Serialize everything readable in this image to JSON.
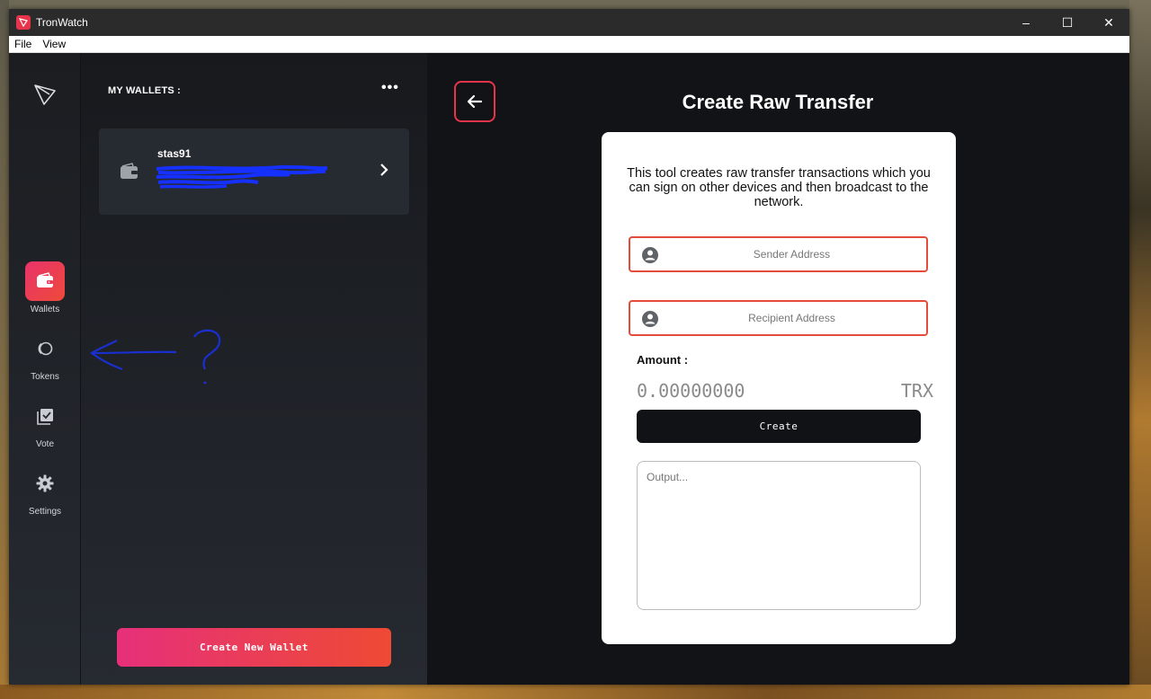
{
  "window": {
    "title": "TronWatch",
    "controls": {
      "minimize": "–",
      "maximize": "☐",
      "close": "✕"
    }
  },
  "menu": {
    "items": [
      "File",
      "View"
    ]
  },
  "sidebar": {
    "items": [
      {
        "label": "Wallets",
        "icon": "wallet-icon",
        "active": true
      },
      {
        "label": "Tokens",
        "icon": "tokens-icon",
        "active": false
      },
      {
        "label": "Vote",
        "icon": "vote-icon",
        "active": false
      },
      {
        "label": "Settings",
        "icon": "gear-icon",
        "active": false
      }
    ]
  },
  "wallets": {
    "title": "MY WALLETS :",
    "more": "•••",
    "list": [
      {
        "name": "stas91"
      }
    ],
    "create_button": "Create New Wallet"
  },
  "main": {
    "title": "Create Raw Transfer",
    "description": "This tool creates raw transfer transactions which you can sign on other devices and then broadcast to the network.",
    "sender_placeholder": "Sender Address",
    "recipient_placeholder": "Recipient Address",
    "amount_label": "Amount :",
    "amount_value": "0.00000000",
    "amount_unit": "TRX",
    "create_button": "Create",
    "output_placeholder": "Output..."
  },
  "colors": {
    "accent": "#e8344a",
    "gradient_start": "#e6307a",
    "gradient_end": "#ee4a34",
    "field_border": "#e54b3a",
    "annotation": "#1a2fd0"
  }
}
